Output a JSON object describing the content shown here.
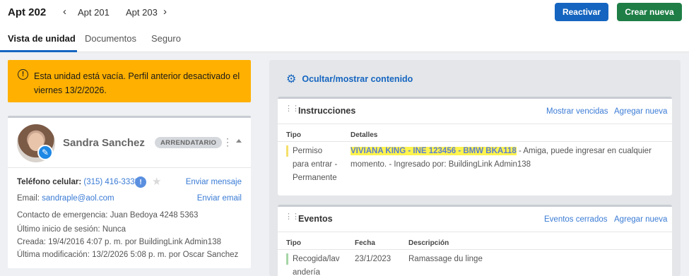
{
  "header": {
    "title": "Apt 202",
    "prev_label": "Apt 201",
    "next_label": "Apt 203",
    "prev_chevron": "‹",
    "next_chevron": "›",
    "reactivate_label": "Reactivar",
    "create_label": "Crear nueva",
    "colors": {
      "primary": "#1565c0",
      "success": "#1e7e46"
    }
  },
  "tabs": [
    {
      "label": "Vista de unidad",
      "active": true
    },
    {
      "label": "Documentos",
      "active": false
    },
    {
      "label": "Seguro",
      "active": false
    }
  ],
  "alert": {
    "icon": "!",
    "text": "Esta unidad está vacía. Perfil anterior desactivado el viernes 13/2/2026.",
    "color": "#ffb000"
  },
  "resident": {
    "name": "Sandra Sanchez",
    "role": "ARRENDATARIO",
    "kebab": "⋮",
    "phone_label": "Teléfono celular:",
    "phone": "(315) 416-3338",
    "verified": "!",
    "star": "★",
    "send_message": "Enviar mensaje",
    "email_label": "Email:",
    "email": "sandraple@aol.com",
    "send_email": "Enviar email",
    "emergency_label": "Contacto de emergencia:",
    "emergency": "Juan Bedoya 4248 5363",
    "last_login_label": "Último inicio de sesión:",
    "last_login": "Nunca",
    "created_label": "Creada:",
    "created": "19/4/2016 4:07 p. m. por BuildingLink Admin138",
    "modified_label": "Última modificación:",
    "modified": "13/2/2026 5:08 p. m. por Oscar Sanchez"
  },
  "panel": {
    "toggle_label": "Ocultar/mostrar contenido",
    "gear_icon": "⚙"
  },
  "instructions": {
    "title": "Instrucciones",
    "show_expired": "Mostrar vencidas",
    "add_new": "Agregar nueva",
    "columns": {
      "type": "Tipo",
      "details": "Detalles"
    },
    "row": {
      "type_line1": "Permiso",
      "type_line2": "para entrar -",
      "type_line3": "Permanente",
      "highlight": "VIVIANA KING - INE 123456 - BMW BKA118",
      "details_rest": " - Amiga, puede ingresar en cualquier",
      "details_line2": "momento.  - Ingresado por: BuildingLink Admin138",
      "accent": "#f5e06b"
    }
  },
  "events": {
    "title": "Eventos",
    "closed": "Eventos cerrados",
    "add_new": "Agregar nueva",
    "columns": {
      "type": "Tipo",
      "date": "Fecha",
      "description": "Descripción"
    },
    "row": {
      "type_line1": "Recogida/lav",
      "type_line2": "andería",
      "date": "23/1/2023",
      "description": "Ramassage du linge",
      "accent": "#a5d6a7"
    }
  }
}
